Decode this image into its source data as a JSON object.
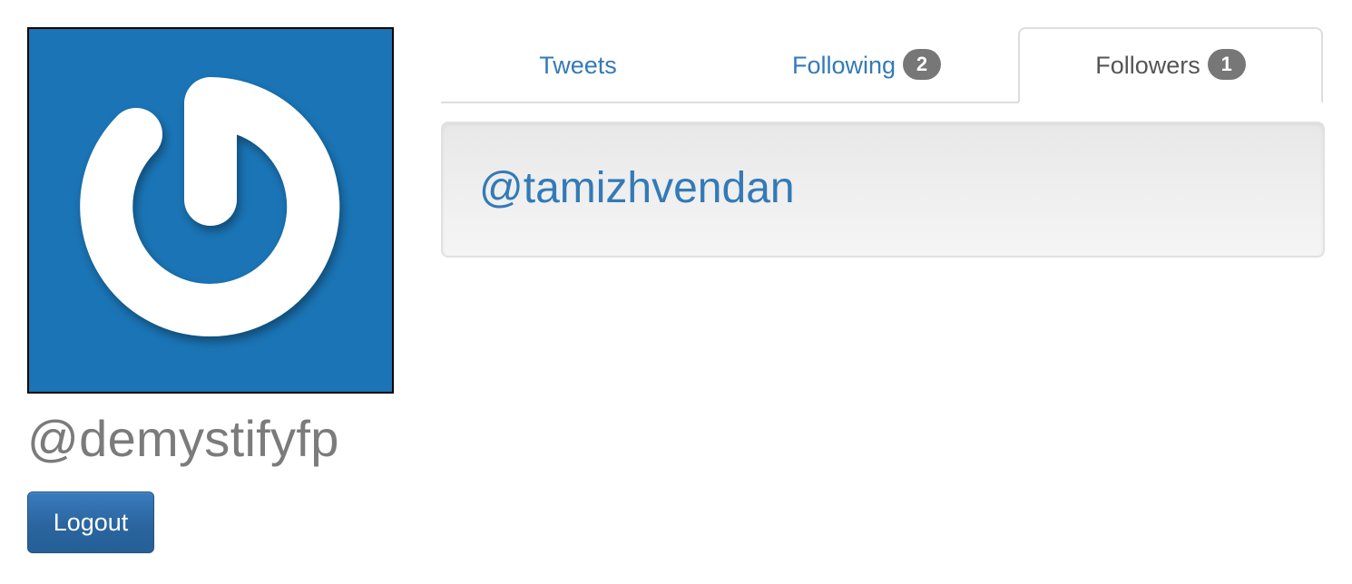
{
  "profile": {
    "handle": "@demystifyfp",
    "avatar_icon": "power-logo-icon",
    "avatar_bg_color": "#1a74b5",
    "logout_label": "Logout"
  },
  "tabs": [
    {
      "label": "Tweets",
      "active": false
    },
    {
      "label": "Following",
      "badge": "2",
      "active": false
    },
    {
      "label": "Followers",
      "badge": "1",
      "active": true
    }
  ],
  "followers": [
    {
      "handle": "@tamizhvendan"
    }
  ],
  "colors": {
    "link": "#337ab7",
    "active_tab_text": "#555555",
    "badge_bg": "#777777",
    "button_bg": "#2a659f"
  }
}
